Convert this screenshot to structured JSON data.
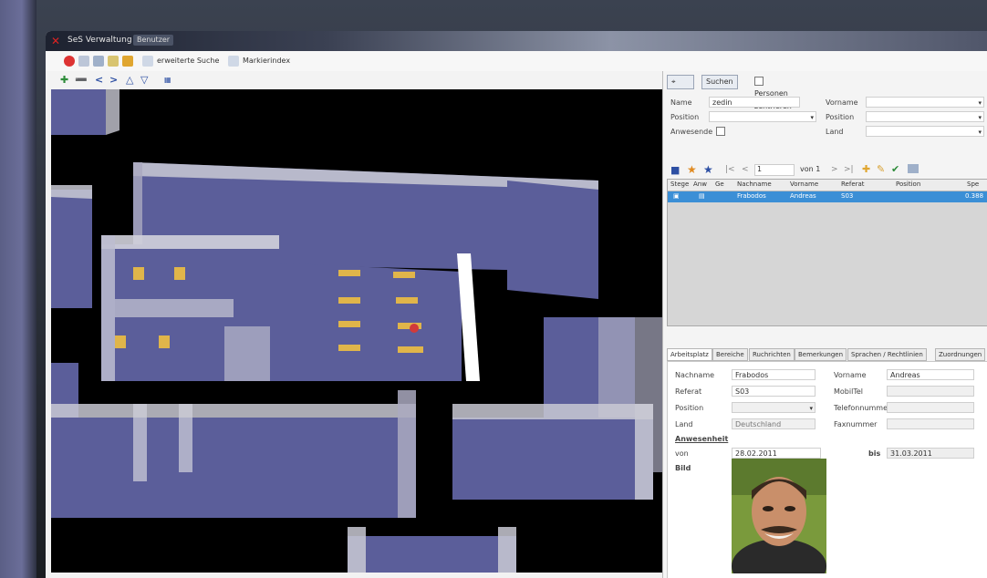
{
  "window": {
    "title": "SeS Verwaltung",
    "subtitle": "Benutzer"
  },
  "toolbar": {
    "extended_search_label": "erweiterte Suche",
    "markers_label": "Markierindex"
  },
  "search_panel": {
    "tabs": [
      "",
      "Suchen",
      "Personen zentrieren"
    ],
    "fields": {
      "name_label": "Name",
      "name_value": "zedin",
      "vorname_label": "Vorname",
      "vorname_value": "",
      "position_label": "Position",
      "position_value": "",
      "pos2_label": "Position",
      "pos2_value": "",
      "anwesende_label": "Anwesende",
      "land_label": "Land",
      "land_value": ""
    },
    "pager": {
      "page_value": "1",
      "page_total": "von 1"
    }
  },
  "grid": {
    "columns": [
      "Stege",
      "Anw",
      "Ge",
      "Nachname",
      "Vorname",
      "Referat",
      "Position",
      "Spe"
    ],
    "rows": [
      [
        "",
        "",
        "",
        "Frabodos",
        "Andreas",
        "S03",
        "",
        "0.388"
      ]
    ]
  },
  "detail_tabs": [
    "Arbeitsplatz",
    "Bereiche",
    "Ruchrichten",
    "Bemerkungen",
    "Sprachen / Rechtlinien",
    "Zuordnungen"
  ],
  "detail": {
    "nachname_label": "Nachname",
    "nachname_value": "Frabodos",
    "vorname_label": "Vorname",
    "vorname_value": "Andreas",
    "referat_label": "Referat",
    "referat_value": "S03",
    "mobiltel_label": "MobilTel",
    "mobiltel_value": "",
    "position_label": "Position",
    "position_value": "",
    "telefonnummer_label": "Telefonnummer",
    "telefonnummer_value": "",
    "land_label": "Land",
    "land_value": "Deutschland",
    "faxnummer_label": "Faxnummer",
    "faxnummer_value": "",
    "anwesenheit_label": "Anwesenheit",
    "von_label": "von",
    "von_value": "28.02.2011",
    "bis_label": "bis",
    "bis_value": "31.03.2011",
    "bild_label": "Bild"
  },
  "colors": {
    "accent": "#3b8fd6",
    "floor": "#5b5e9a",
    "wall": "#c9c9d4",
    "desk": "#e0b54a",
    "viewport_bg": "#000000"
  },
  "icons": [
    "app-logo-icon",
    "arrow-icon",
    "chevron-icon",
    "star-icon",
    "pencil-icon",
    "magnifier-icon"
  ]
}
